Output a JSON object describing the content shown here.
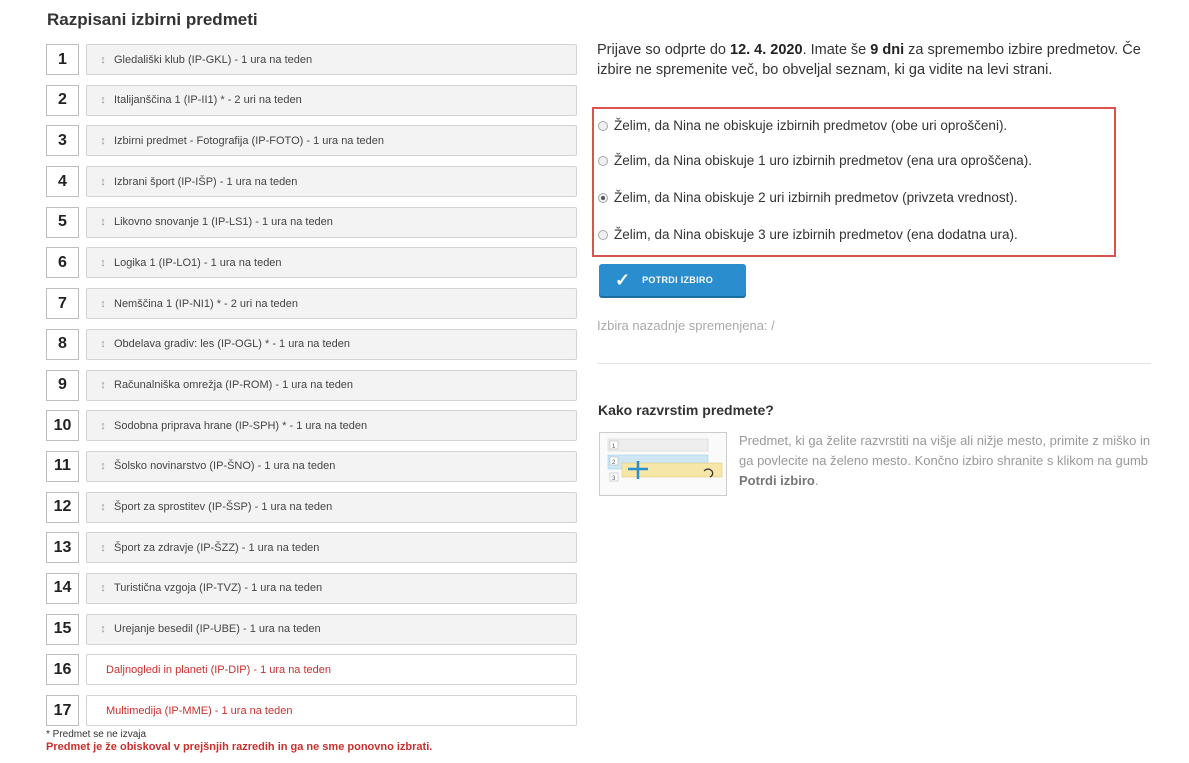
{
  "page_title": "Razpisani izbirni predmeti",
  "subjects": [
    {
      "num": "1",
      "label": "Gledališki klub (IP-GKL) - 1 ura na teden",
      "disabled": false
    },
    {
      "num": "2",
      "label": "Italijanščina 1 (IP-II1) * - 2 uri na teden",
      "disabled": false
    },
    {
      "num": "3",
      "label": "Izbirni predmet - Fotografija (IP-FOTO) - 1 ura na teden",
      "disabled": false
    },
    {
      "num": "4",
      "label": "Izbrani šport (IP-IŠP) - 1 ura na teden",
      "disabled": false
    },
    {
      "num": "5",
      "label": "Likovno snovanje 1 (IP-LS1) - 1 ura na teden",
      "disabled": false
    },
    {
      "num": "6",
      "label": "Logika 1 (IP-LO1) - 1 ura na teden",
      "disabled": false
    },
    {
      "num": "7",
      "label": "Nemščina 1 (IP-NI1) * - 2 uri na teden",
      "disabled": false
    },
    {
      "num": "8",
      "label": "Obdelava gradiv: les (IP-OGL) * - 1 ura na teden",
      "disabled": false
    },
    {
      "num": "9",
      "label": "Računalniška omrežja (IP-ROM) - 1 ura na teden",
      "disabled": false
    },
    {
      "num": "10",
      "label": "Sodobna priprava hrane (IP-SPH) * - 1 ura na teden",
      "disabled": false
    },
    {
      "num": "11",
      "label": "Šolsko novinarstvo (IP-ŠNO) - 1 ura na teden",
      "disabled": false
    },
    {
      "num": "12",
      "label": "Šport za sprostitev (IP-ŠSP) - 1 ura na teden",
      "disabled": false
    },
    {
      "num": "13",
      "label": "Šport za zdravje (IP-ŠZZ) - 1 ura na teden",
      "disabled": false
    },
    {
      "num": "14",
      "label": "Turistična vzgoja (IP-TVZ) - 1 ura na teden",
      "disabled": false
    },
    {
      "num": "15",
      "label": "Urejanje besedil (IP-UBE) - 1 ura na teden",
      "disabled": false
    },
    {
      "num": "16",
      "label": "Daljnogledi in planeti (IP-DIP) - 1 ura na teden",
      "disabled": true
    },
    {
      "num": "17",
      "label": "Multimedija (IP-MME) - 1 ura na teden",
      "disabled": true
    }
  ],
  "footnotes": {
    "not_running": "* Predmet se ne izvaja",
    "already_taken": "Predmet je že obiskoval v prejšnjih razredih in ga ne sme ponovno izbrati."
  },
  "info": {
    "part1": "Prijave so odprte do ",
    "deadline": "12. 4. 2020",
    "part2": ". Imate še ",
    "days_left": "9 dni",
    "part3": " za spremembo izbire predmetov. Če izbire ne spremenite več, bo obveljal seznam, ki ga vidite na levi strani."
  },
  "options": [
    {
      "label": "Želim, da Nina ne obiskuje izbirnih predmetov (obe uri oproščeni).",
      "checked": false
    },
    {
      "label": "Želim, da Nina obiskuje 1 uro izbirnih predmetov (ena ura oproščena).",
      "checked": false
    },
    {
      "label": "Želim, da Nina obiskuje 2 uri izbirnih predmetov (privzeta vrednost).",
      "checked": true
    },
    {
      "label": "Želim, da Nina obiskuje 3 ure izbirnih predmetov (ena dodatna ura).",
      "checked": false
    }
  ],
  "confirm_button": "POTRDI IZBIRO",
  "last_changed": "Izbira nazadnje spremenjena: /",
  "how_to": {
    "title": "Kako razvrstim predmete?",
    "text_part1": "Predmet, ki ga želite razvrstiti na višje ali nižje mesto, primite z miško in ga povlecite na želeno mesto. Končno izbiro shranite s klikom na gumb ",
    "text_bold": "Potrdi izbiro",
    "text_part2": ".",
    "illustration_numbers": [
      "1",
      "2",
      "3"
    ]
  },
  "colors": {
    "accent_blue": "#2a8dcd",
    "highlight_red": "#d9534f",
    "disabled_text": "#c9302c"
  }
}
